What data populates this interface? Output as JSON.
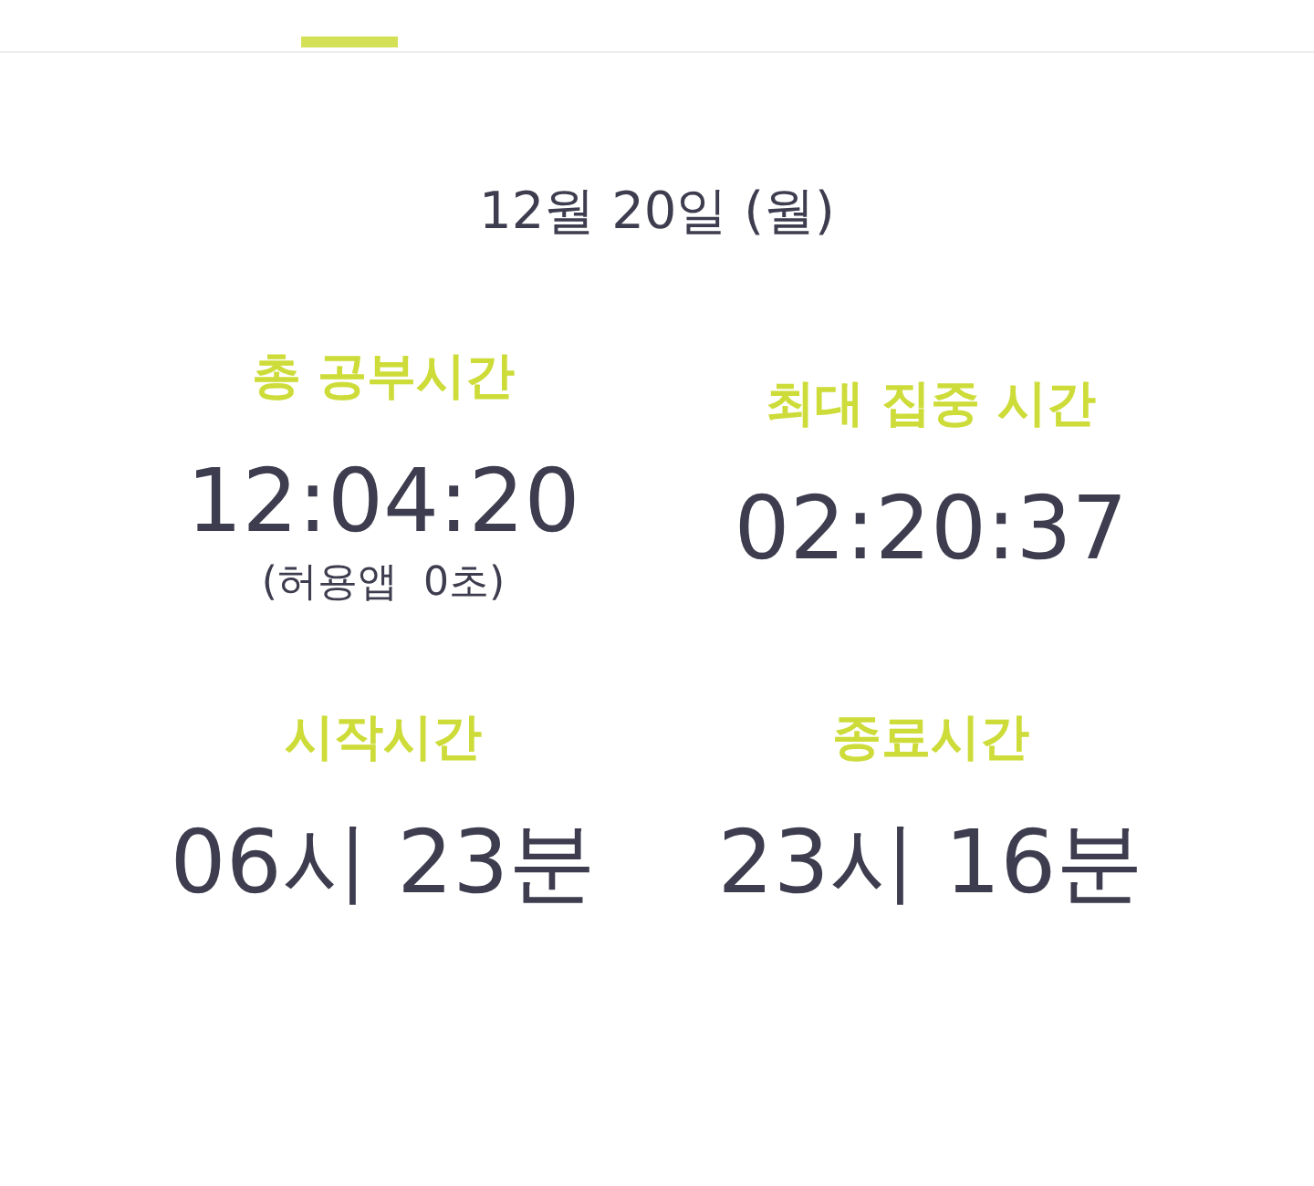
{
  "date": "12월 20일 (월)",
  "stats": [
    {
      "label": "총 공부시간",
      "value": "12:04:20",
      "note": "(허용앱  0초)"
    },
    {
      "label": "최대 집중 시간",
      "value": "02:20:37"
    },
    {
      "label": "시작시간",
      "value": "06시 23분"
    },
    {
      "label": "종료시간",
      "value": "23시 16분"
    }
  ]
}
